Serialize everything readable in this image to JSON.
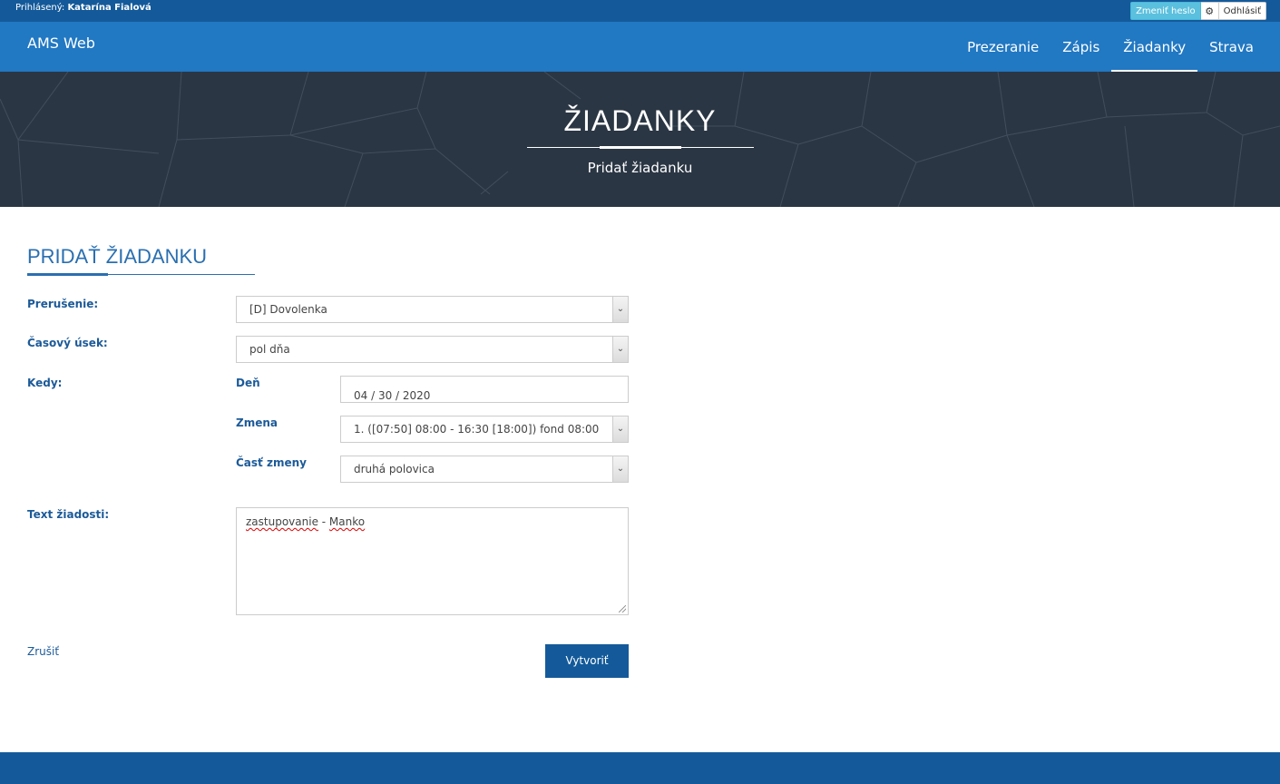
{
  "topbar": {
    "login_label": "Prihlásený:",
    "user_name": "Katarína Fialová",
    "change_password": "Zmeniť heslo",
    "logout": "Odhlásiť"
  },
  "navbar": {
    "brand": "AMS Web",
    "items": [
      {
        "label": "Prezeranie"
      },
      {
        "label": "Zápis"
      },
      {
        "label": "Žiadanky",
        "active": true
      },
      {
        "label": "Strava"
      }
    ]
  },
  "hero": {
    "title": "ŽIADANKY",
    "subtitle": "Pridať žiadanku"
  },
  "section": {
    "title": "PRIDAŤ ŽIADANKU"
  },
  "form": {
    "prerusenie": {
      "label": "Prerušenie:",
      "value": "[D] Dovolenka"
    },
    "casovy_usek": {
      "label": "Časový úsek:",
      "value": "pol dňa"
    },
    "kedy": {
      "label": "Kedy:"
    },
    "den": {
      "label": "Deň",
      "value": "04 / 30 / 2020"
    },
    "zmena": {
      "label": "Zmena",
      "value": "1. ([07:50] 08:00 - 16:30 [18:00]) fond 08:00"
    },
    "cast_zmeny": {
      "label": "Časť zmeny",
      "value": "druhá polovica"
    },
    "text": {
      "label": "Text žiadosti:",
      "word1": "zastupovanie",
      "sep": " - ",
      "word2": "Manko"
    }
  },
  "actions": {
    "cancel": "Zrušiť",
    "create": "Vytvoriť"
  },
  "colors": {
    "topbar": "#145a9a",
    "navbar": "#2178c3",
    "hero": "#2b3644",
    "label": "#1c5a98",
    "info_button": "#5bc0de"
  }
}
